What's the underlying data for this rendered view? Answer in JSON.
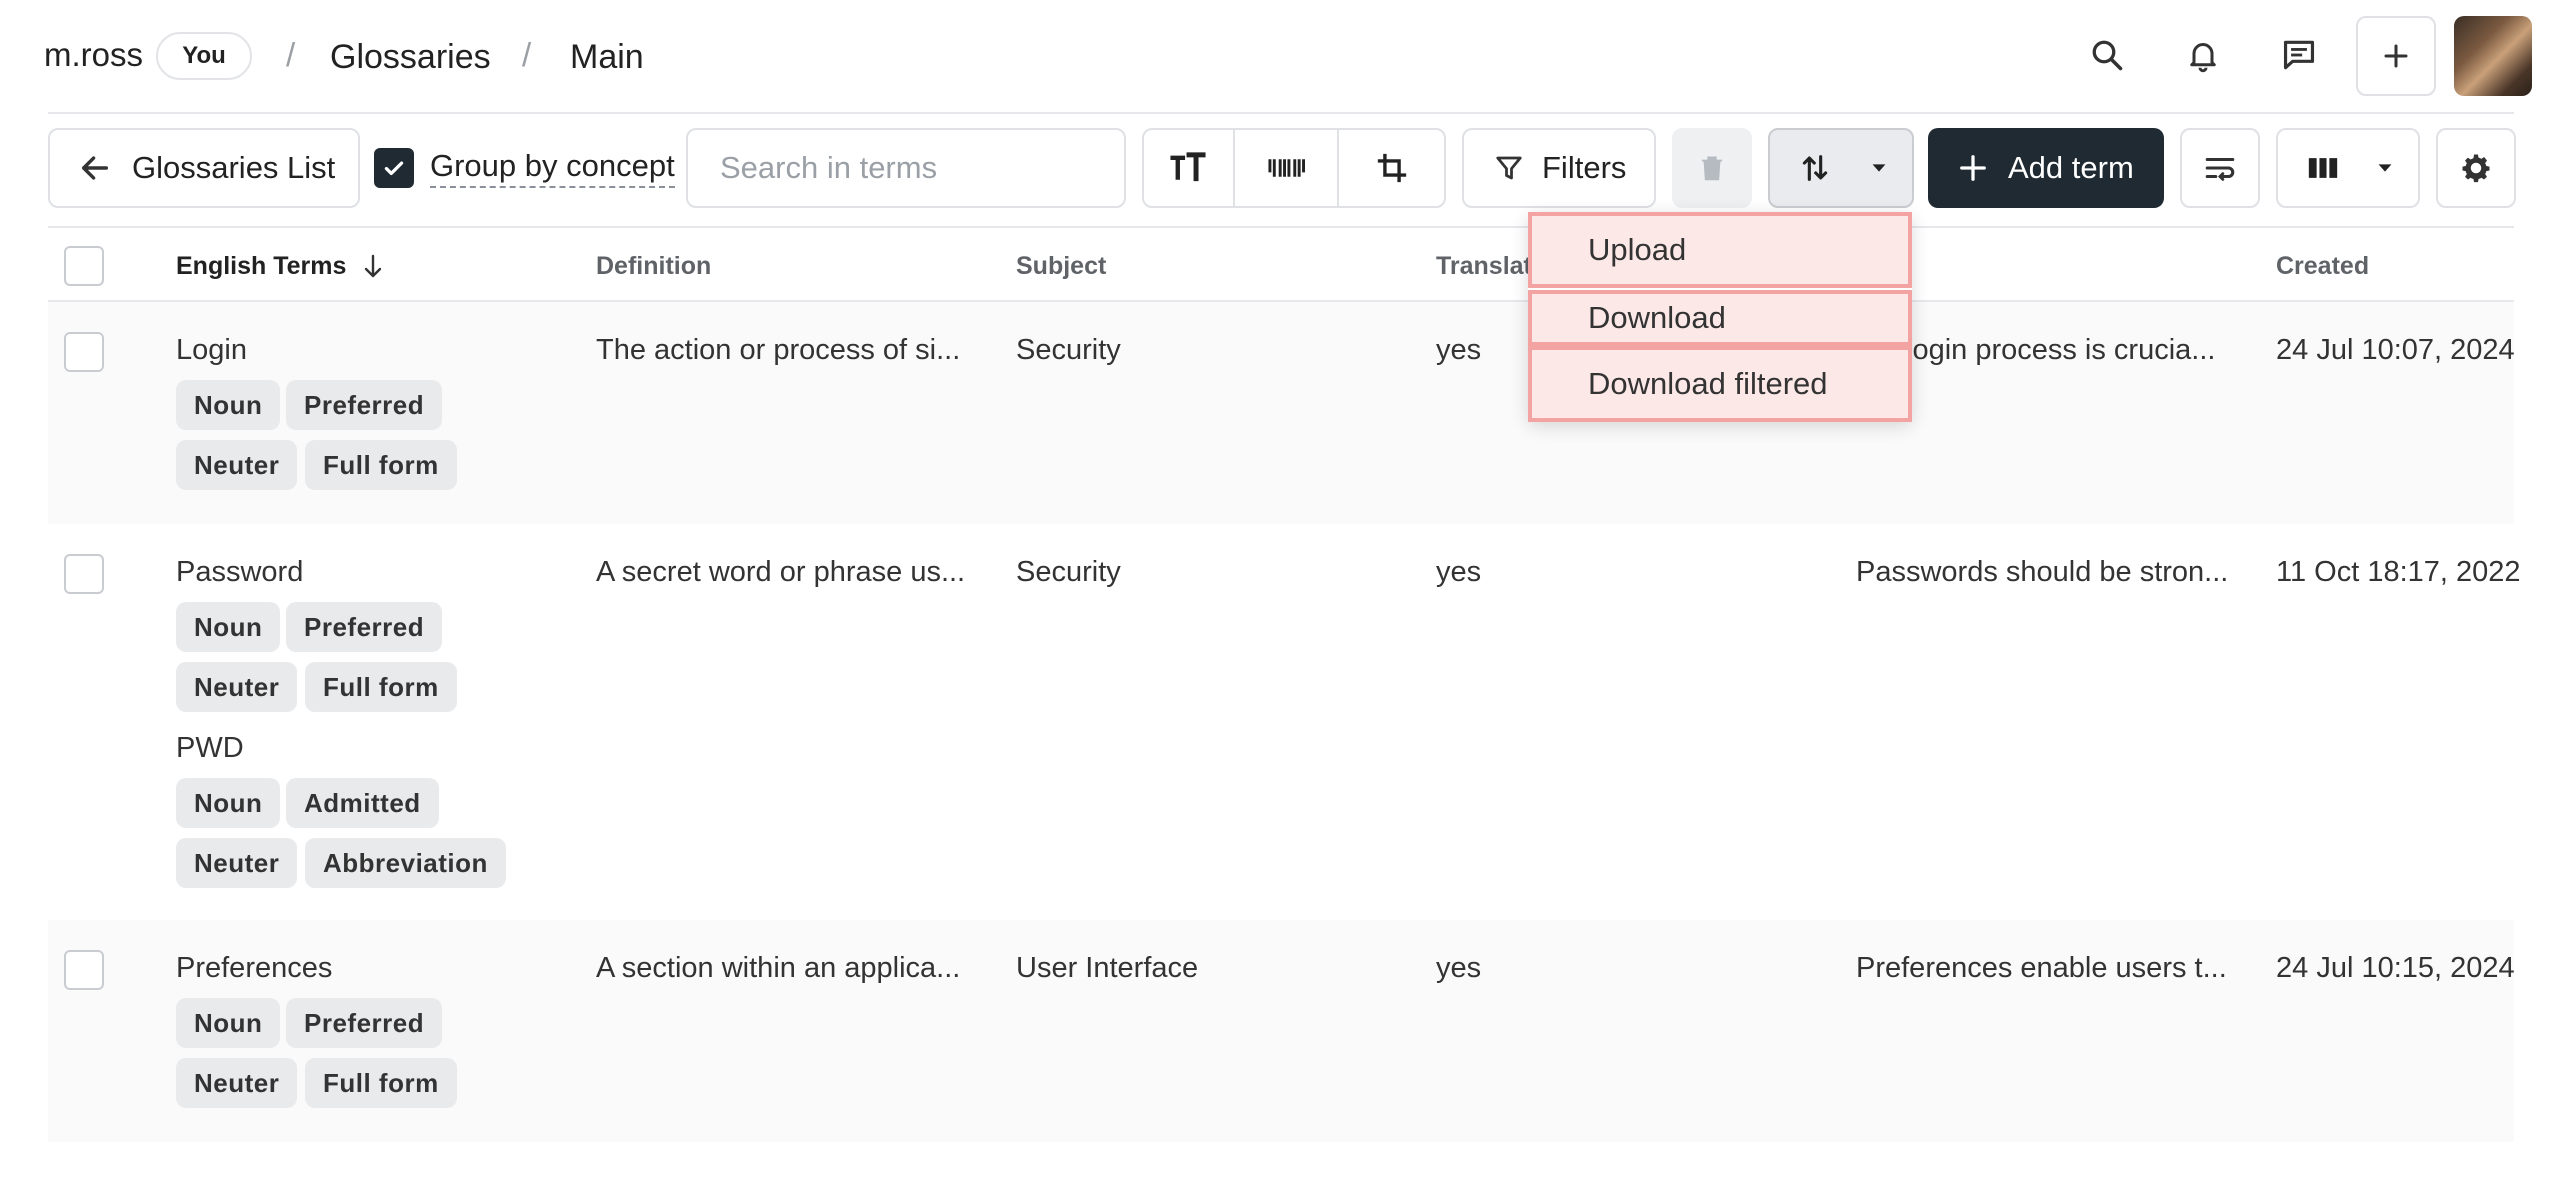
{
  "header": {
    "user": "m.ross",
    "you_badge": "You",
    "separator": "/",
    "crumbs": [
      "Glossaries",
      "Main"
    ]
  },
  "toolbar": {
    "back_label": "Glossaries List",
    "group_by_label": "Group by concept",
    "group_by_checked": true,
    "search_placeholder": "Search in terms",
    "filters_label": "Filters",
    "add_term_label": "Add term"
  },
  "dropdown": {
    "items": [
      "Upload",
      "Download",
      "Download filtered"
    ]
  },
  "table": {
    "columns": [
      "English Terms",
      "Definition",
      "Subject",
      "Translat",
      "",
      "Created"
    ],
    "rows": [
      {
        "terms": [
          {
            "text": "Login",
            "tags": [
              [
                "Noun",
                "Preferred"
              ],
              [
                "Neuter",
                "Full form"
              ]
            ]
          }
        ],
        "definition": "The action or process of si...",
        "subject": "Security",
        "translatable": "yes",
        "context": "login process is crucia...",
        "created": "24 Jul 10:07, 2024"
      },
      {
        "terms": [
          {
            "text": "Password",
            "tags": [
              [
                "Noun",
                "Preferred"
              ],
              [
                "Neuter",
                "Full form"
              ]
            ]
          },
          {
            "text": "PWD",
            "tags": [
              [
                "Noun",
                "Admitted"
              ],
              [
                "Neuter",
                "Abbreviation"
              ]
            ]
          }
        ],
        "definition": "A secret word or phrase us...",
        "subject": "Security",
        "translatable": "yes",
        "context": "Passwords should be stron...",
        "created": "11 Oct 18:17, 2022"
      },
      {
        "terms": [
          {
            "text": "Preferences",
            "tags": [
              [
                "Noun",
                "Preferred"
              ],
              [
                "Neuter",
                "Full form"
              ]
            ]
          }
        ],
        "definition": "A section within an applica...",
        "subject": "User Interface",
        "translatable": "yes",
        "context": "Preferences enable users t...",
        "created": "24 Jul 10:15, 2024"
      }
    ]
  },
  "colors": {
    "primary_dark": "#1f2a33",
    "menu_highlight_border": "#f4a3a3",
    "menu_highlight_bg": "#fde8e8"
  }
}
